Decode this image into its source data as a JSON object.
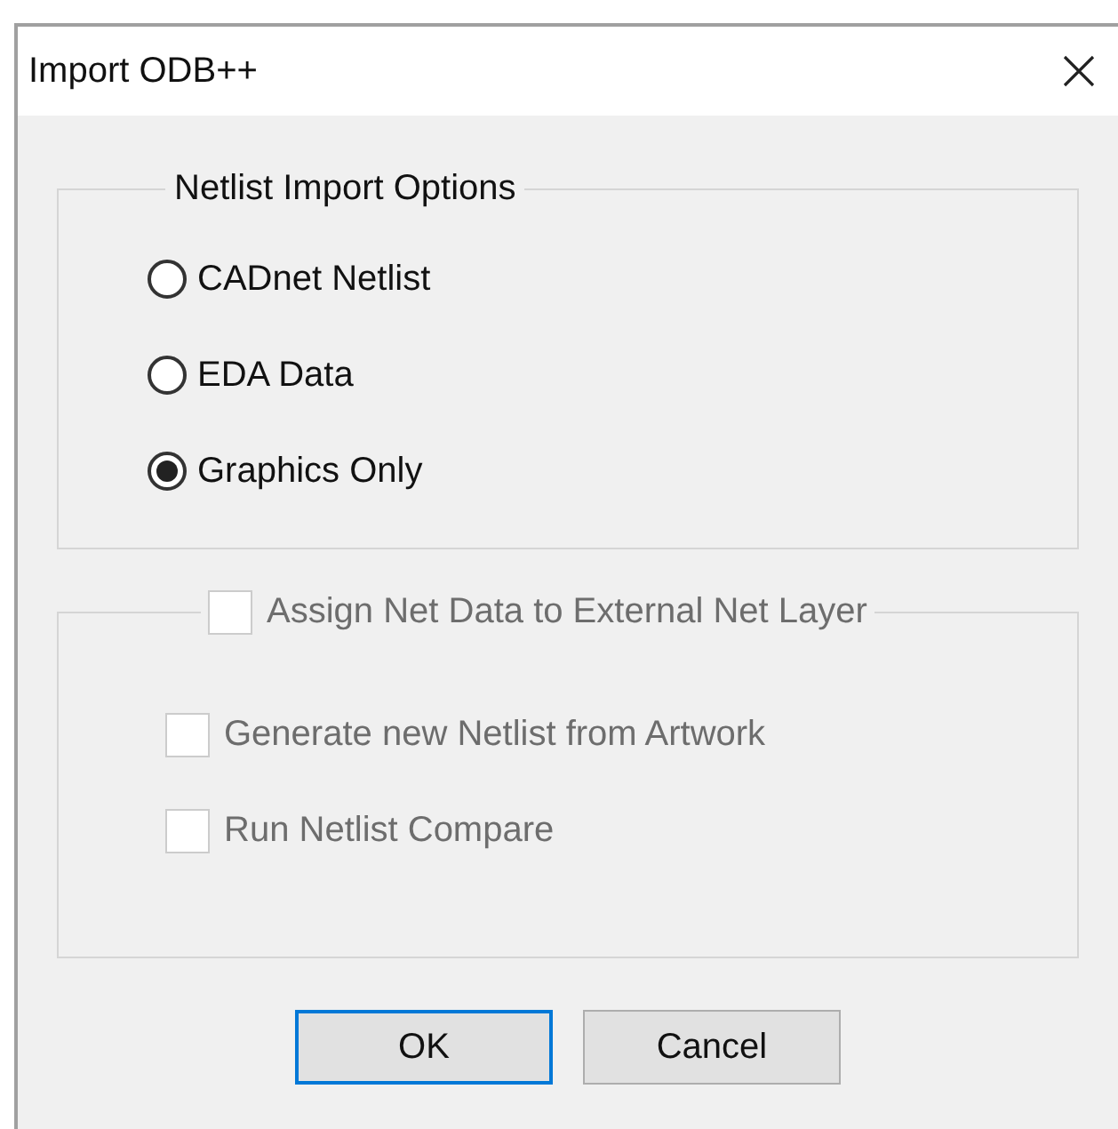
{
  "window": {
    "title": "Import ODB++"
  },
  "netlist_group": {
    "title": "Netlist Import Options",
    "options": [
      {
        "label": "CADnet Netlist",
        "selected": false
      },
      {
        "label": "EDA Data",
        "selected": false
      },
      {
        "label": "Graphics Only",
        "selected": true
      }
    ]
  },
  "net_layer_group": {
    "label": "Assign Net Data to External Net Layer",
    "checked": false,
    "disabled": true,
    "options": [
      {
        "label": "Generate new Netlist from Artwork",
        "checked": false,
        "disabled": true
      },
      {
        "label": "Run Netlist Compare",
        "checked": false,
        "disabled": true
      }
    ]
  },
  "buttons": [
    {
      "label": "OK",
      "default": true
    },
    {
      "label": "Cancel",
      "default": false
    }
  ]
}
